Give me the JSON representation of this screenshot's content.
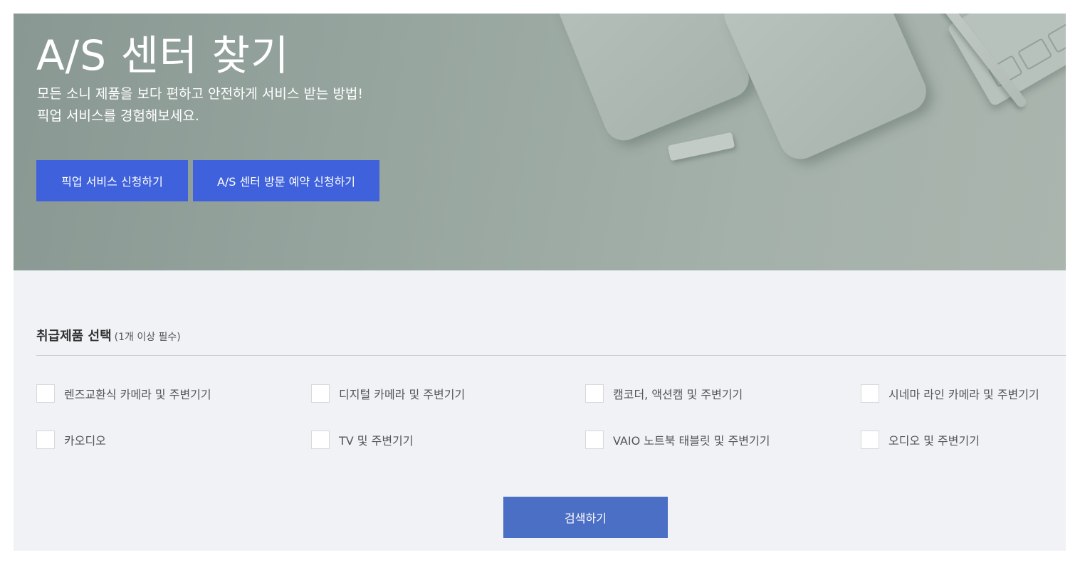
{
  "hero": {
    "title": "A/S 센터 찾기",
    "description_line1": "모든 소니 제품을 보다 편하고 안전하게 서비스 받는 방법!",
    "description_line2": "픽업 서비스를 경험해보세요.",
    "pickup_button": "픽업 서비스 신청하기",
    "visit_button": "A/S 센터 방문 예약 신청하기"
  },
  "filter": {
    "heading": "취급제품 선택",
    "note": "(1개 이상 필수)",
    "options": [
      {
        "label": "렌즈교환식 카메라 및 주변기기",
        "checked": false
      },
      {
        "label": "디지털 카메라 및 주변기기",
        "checked": false
      },
      {
        "label": "캠코더, 액션캠 및 주변기기",
        "checked": false
      },
      {
        "label": "시네마 라인 카메라 및 주변기기",
        "checked": false
      },
      {
        "label": "카오디오",
        "checked": false
      },
      {
        "label": "TV 및 주변기기",
        "checked": false
      },
      {
        "label": "VAIO 노트북 태블릿 및 주변기기",
        "checked": false
      },
      {
        "label": "오디오 및 주변기기",
        "checked": false
      }
    ],
    "search_button": "검색하기"
  },
  "colors": {
    "primary_button": "#3f62dc",
    "search_button": "#4b6fc4",
    "filter_background": "#f0f2f6",
    "hero_background": "#97a59f"
  }
}
